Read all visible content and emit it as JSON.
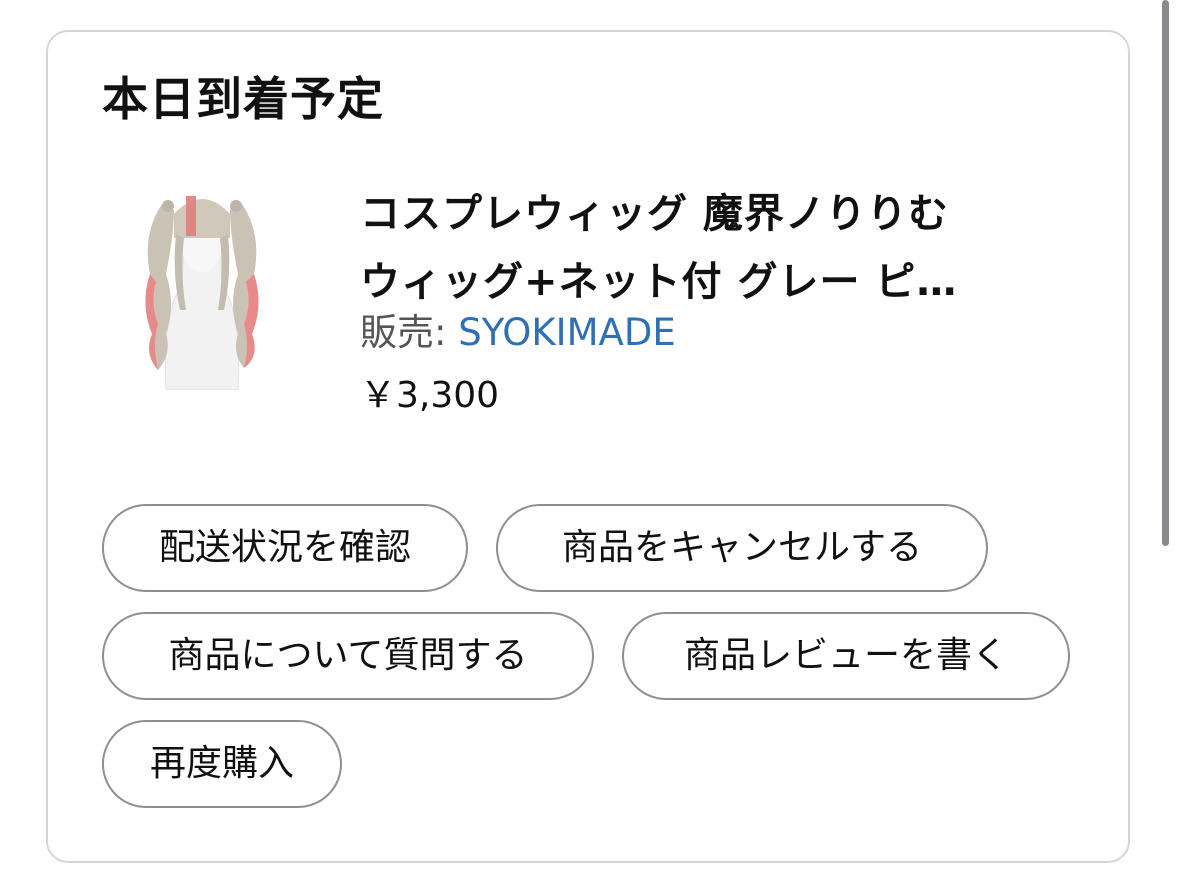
{
  "card": {
    "heading": "本日到着予定",
    "product": {
      "thumbnail": "wig-product-image",
      "title_line1": "コスプレウィッグ 魔界ノりりむ",
      "title_line2": "ウィッグ+ネット付 グレー ピ…",
      "seller_label": "販売:",
      "seller_name": "SYOKIMADE",
      "price": "￥3,300"
    },
    "actions": [
      {
        "label": "配送状況を確認"
      },
      {
        "label": "商品をキャンセルする"
      },
      {
        "label": "商品について質問する"
      },
      {
        "label": "商品レビューを書く"
      },
      {
        "label": "再度購入"
      }
    ]
  },
  "colors": {
    "link": "#2f6fb3",
    "border": "#d5d5d9",
    "button_border": "#8e8e93"
  }
}
